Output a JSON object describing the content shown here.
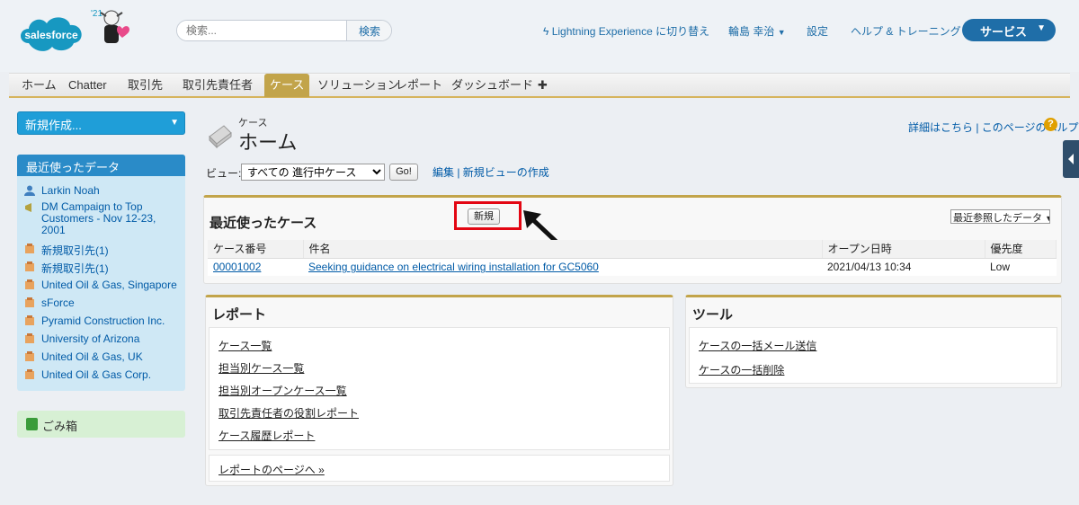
{
  "header": {
    "logo_text": "salesforce",
    "mascot_badge": "'21",
    "search_placeholder": "検索...",
    "search_button": "検索",
    "lightning_link": "Lightning Experience に切り替え",
    "user_name": "輪島 幸治",
    "setup_link": "設定",
    "help_link": "ヘルプ & トレーニング",
    "app_menu": "サービス"
  },
  "tabs": [
    {
      "label": "ホーム"
    },
    {
      "label": "Chatter"
    },
    {
      "label": "取引先"
    },
    {
      "label": "取引先責任者"
    },
    {
      "label": "ケース",
      "active": true
    },
    {
      "label": "ソリューション"
    },
    {
      "label": "レポート"
    },
    {
      "label": "ダッシュボード"
    },
    {
      "label": "✚"
    }
  ],
  "sidebar": {
    "create_new": "新規作成...",
    "recent_title": "最近使ったデータ",
    "recent_items": [
      {
        "label": "Larkin Noah",
        "icon": "contact-icon"
      },
      {
        "label": "DM Campaign to Top Customers - Nov 12-23, 2001",
        "icon": "campaign-icon"
      },
      {
        "label": "新規取引先(1)",
        "icon": "account-icon"
      },
      {
        "label": "新規取引先(1)",
        "icon": "account-icon"
      },
      {
        "label": "United Oil & Gas, Singapore",
        "icon": "account-icon"
      },
      {
        "label": "sForce",
        "icon": "account-icon"
      },
      {
        "label": "Pyramid Construction Inc.",
        "icon": "account-icon"
      },
      {
        "label": "University of Arizona",
        "icon": "account-icon"
      },
      {
        "label": "United Oil & Gas, UK",
        "icon": "account-icon"
      },
      {
        "label": "United Oil & Gas Corp.",
        "icon": "account-icon"
      }
    ],
    "recycle_bin": "ごみ箱"
  },
  "page": {
    "object_type": "ケース",
    "title": "ホーム",
    "help_links": "詳細はこちら | このページのヘルプ",
    "view_label": "ビュー:",
    "view_selected": "すべての 進行中ケース",
    "go_button": "Go!",
    "edit_links": "編集 | 新規ビューの作成"
  },
  "recent_cases": {
    "title": "最近使ったケース",
    "new_button": "新規",
    "sort_selected": "最近参照したデータ",
    "columns": [
      "ケース番号",
      "件名",
      "オープン日時",
      "優先度"
    ],
    "rows": [
      {
        "number": "00001002",
        "subject": "Seeking guidance on electrical wiring installation for GC5060",
        "opened": "2021/04/13 10:34",
        "priority": "Low"
      }
    ]
  },
  "reports": {
    "title": "レポート",
    "links": [
      "ケース一覧",
      "担当別ケース一覧",
      "担当別オープンケース一覧",
      "取引先責任者の役割レポート",
      "ケース履歴レポート"
    ],
    "more_link": "レポートのページへ »"
  },
  "tools": {
    "title": "ツール",
    "links": [
      "ケースの一括メール送信",
      "ケースの一括削除"
    ]
  },
  "colors": {
    "accent": "#1f6ea8",
    "tab_active": "#c2a44a",
    "highlight": "#e30613"
  }
}
